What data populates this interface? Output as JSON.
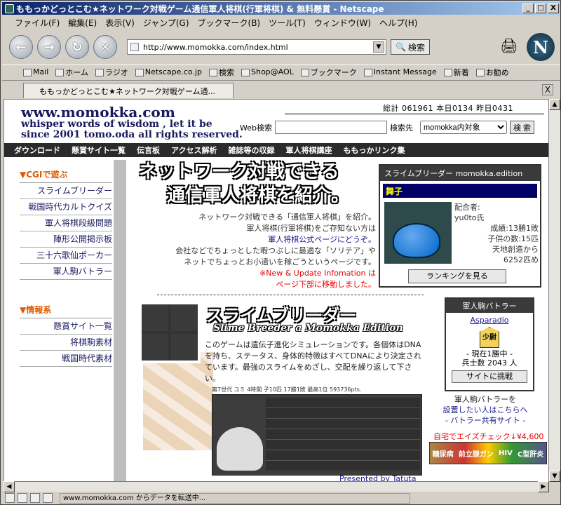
{
  "window": {
    "title": "ももっかどっとこむ★ネットワーク対戦ゲーム通信軍人将棋(行軍将棋) & 無料懸賞 - Netscape",
    "min": "_",
    "max": "□",
    "close": "X"
  },
  "menu": [
    "ファイル(F)",
    "編集(E)",
    "表示(V)",
    "ジャンプ(G)",
    "ブックマーク(B)",
    "ツール(T)",
    "ウィンドウ(W)",
    "ヘルプ(H)"
  ],
  "nav": {
    "back": "←",
    "forward": "→",
    "reload": "↻",
    "stop": "✕",
    "url": "http://www.momokka.com/index.html",
    "search_label": "検索",
    "logo": "N"
  },
  "personal_toolbar": [
    "Mail",
    "ホーム",
    "ラジオ",
    "Netscape.co.jp",
    "検索",
    "Shop@AOL",
    "ブックマーク",
    "Instant Message",
    "新着",
    "お勧め"
  ],
  "tab": {
    "label": "ももっかどっとこむ★ネットワーク対戦ゲーム通...",
    "close": "X"
  },
  "site": {
    "title": "www.momokka.com",
    "subtitle_1": "whisper words of wisdom , let it be",
    "subtitle_2": "since 2001  tomo.oda all rights reserved.",
    "counter": "総計 061961   本日0134   昨日0431",
    "search_label": "Web検索",
    "search_target_label": "検索先",
    "search_target_value": "momokka内対象",
    "search_button": "検 索"
  },
  "topnav": [
    "ダウンロード",
    "懸賞サイト一覧",
    "伝言板",
    "アクセス解析",
    "雑誌等の収録",
    "軍人将棋講座",
    "ももっかリンク集"
  ],
  "sidebar": {
    "cgi_heading": "▼CGIで遊ぶ",
    "cgi_items": [
      "スライムブリーダー",
      "戦国時代カルトクイズ",
      "軍人将棋段級問題",
      "陣形公開掲示板",
      "三十六歌仙ポーカー",
      "軍人駒バトラー"
    ],
    "info_heading": "▼情報系",
    "info_items": [
      "懸賞サイト一覧",
      "将棋駒素材",
      "戦国時代素材"
    ]
  },
  "banner": {
    "line1": "ネットワーク対戦できる",
    "line2": "通信軍人将棋を紹介。"
  },
  "intro": {
    "l1": "ネットワーク対戦できる「通信軍人将棋」を紹介。",
    "l2": "軍人将棋(行軍将棋)をご存知ない方は",
    "l3": "軍人将棋公式ページにどうぞ。",
    "l4": "会社などでちょっとした暇つぶしに最適な「ソリテア」や",
    "l5": "ネットでちょっとお小遣いを稼ごうというページです。",
    "notice1": "※New & Update Infomation は",
    "notice2": "ページ下部に移動しました。"
  },
  "slime_box": {
    "header": "スライムブリーダー momokka.edition",
    "name": "舞子",
    "stats": [
      "配合者:",
      "yu0to氏",
      "成績:13勝1敗",
      "子供の数:15匹",
      "天地創造から",
      "6252匹め"
    ],
    "button": "ランキングを見る"
  },
  "slime_section": {
    "title": "スライムブリーダー",
    "subtitle": "Slime Breeder a Momokka Edition",
    "desc": "このゲームは遺伝子進化シミュレーションです。各個体はDNAを持ち、ステータス、身体的特徴はすべてDNAにより決定されています。最強のスライムをめざし、交配を繰り返して下さい。",
    "caption": "第7世代 ユミ 4時間 子10匹 17勝1敗 最高1位 593736pts.",
    "presented": "Presented by Tatuta"
  },
  "battler": {
    "header": "軍人駒バトラー",
    "name": "Asparadio",
    "piece": "少尉",
    "record1": "- 現在1勝中 -",
    "record2": "兵士数 2043 人",
    "button": "サイトに挑戦",
    "cap1": "軍人駒バトラーを",
    "cap2": "設置したい人はこちらへ",
    "cap3": "- バトラー共有サイト -"
  },
  "ad": {
    "text": "自宅でエイズチェック↓¥4,600",
    "banner_1": "糖尿病",
    "banner_2": "前立腺ガン",
    "banner_3": "HIV",
    "banner_4": "C型肝炎"
  },
  "status": {
    "text": "www.momokka.com からデータを転送中..."
  }
}
